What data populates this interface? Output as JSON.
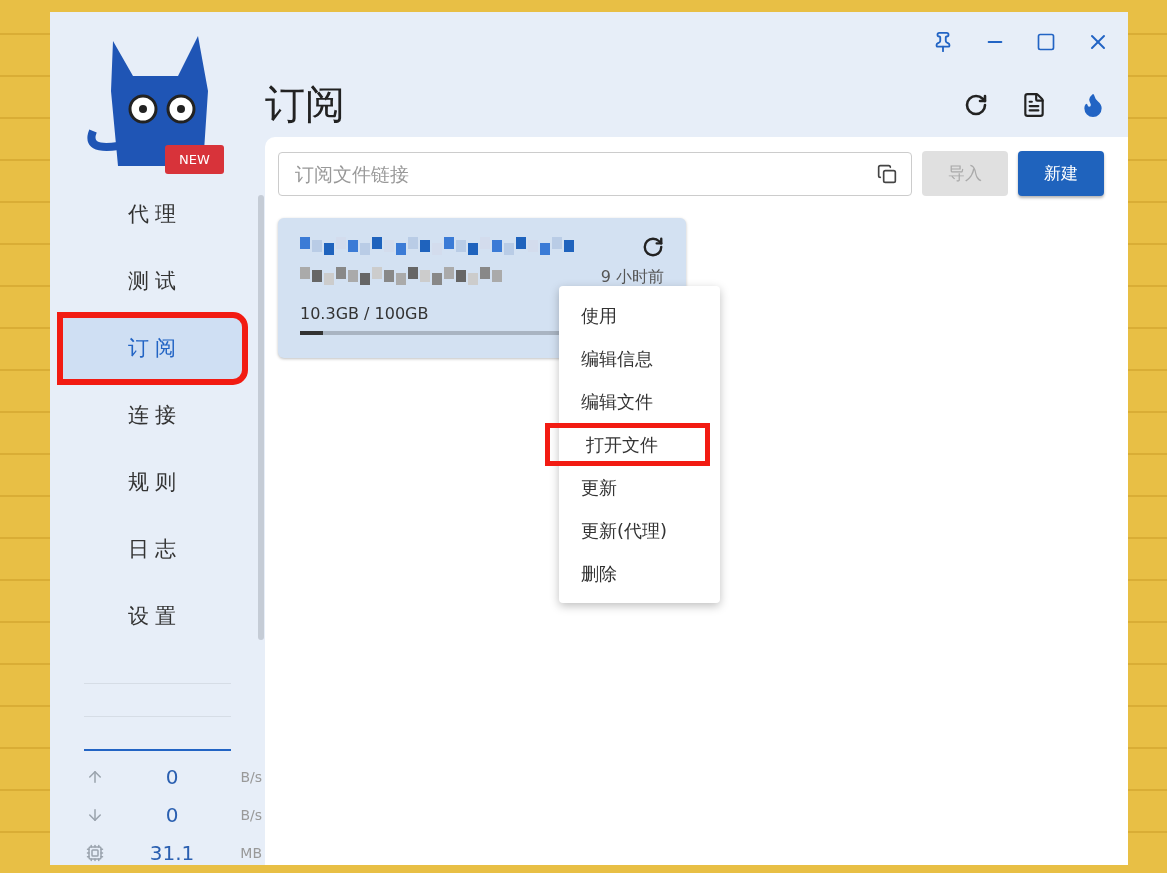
{
  "logo": {
    "badge": "NEW"
  },
  "nav": [
    {
      "label": "代理",
      "selected": false,
      "highlighted": false
    },
    {
      "label": "测试",
      "selected": false,
      "highlighted": false
    },
    {
      "label": "订阅",
      "selected": true,
      "highlighted": true
    },
    {
      "label": "连接",
      "selected": false,
      "highlighted": false
    },
    {
      "label": "规则",
      "selected": false,
      "highlighted": false
    },
    {
      "label": "日志",
      "selected": false,
      "highlighted": false
    },
    {
      "label": "设置",
      "selected": false,
      "highlighted": false
    }
  ],
  "traffic": [
    {
      "kind": "up",
      "value": "0",
      "unit": "B/s"
    },
    {
      "kind": "down",
      "value": "0",
      "unit": "B/s"
    },
    {
      "kind": "memory",
      "value": "31.1",
      "unit": "MB"
    }
  ],
  "page_title": "订阅",
  "url_field": {
    "placeholder": "订阅文件链接"
  },
  "buttons": [
    {
      "label": "导入",
      "disabled": true
    },
    {
      "label": "新建",
      "disabled": false
    }
  ],
  "profiles": [
    {
      "updated": "9 小时前",
      "usage": "10.3GB / 100GB",
      "level": 0.09,
      "selected": true
    }
  ],
  "context_menu": [
    {
      "label": "使用",
      "highlighted": false
    },
    {
      "label": "编辑信息",
      "highlighted": false
    },
    {
      "label": "编辑文件",
      "highlighted": false
    },
    {
      "label": "打开文件",
      "highlighted": true
    },
    {
      "label": "更新",
      "highlighted": false
    },
    {
      "label": "更新(代理)",
      "highlighted": false
    },
    {
      "label": "删除",
      "highlighted": false
    }
  ]
}
